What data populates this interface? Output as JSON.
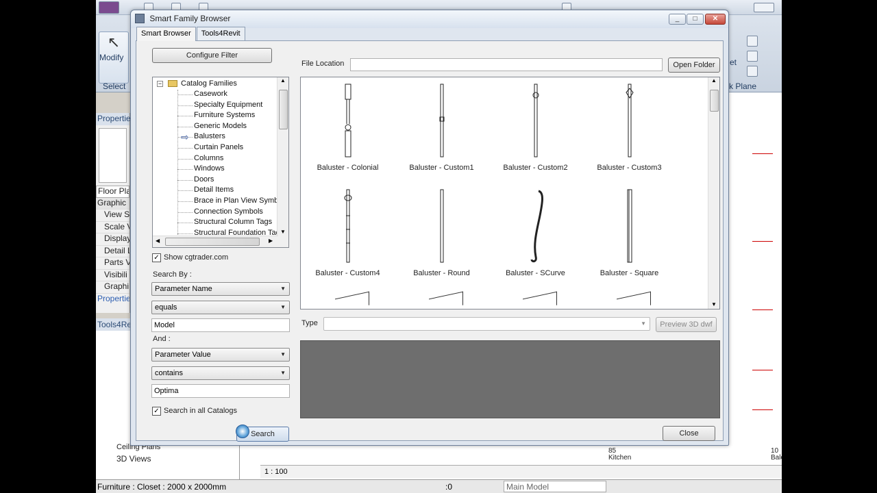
{
  "background": {
    "modify_label": "Modify",
    "select_label": "Select",
    "work_plane_label": "rk Plane",
    "et_label": "et",
    "properties_header": "Propertie",
    "properties_rows": [
      "Floor Pla",
      "Graphic",
      "View S",
      "Scale Va",
      "Display",
      "Detail L",
      "Parts V",
      "Visibili",
      "Graphi",
      "Propertie"
    ],
    "tools4revit_header": "Tools4Re",
    "tree_items": [
      "Ceiling Plans",
      "3D Views"
    ],
    "scale_label": "1 : 100",
    "status_text": "Furniture : Closet : 2000 x 2000mm",
    "status_zero": ":0",
    "main_model": "Main Model",
    "room_labels": [
      "85",
      "Kitchen",
      "10",
      "Balcony"
    ]
  },
  "dialog": {
    "title": "Smart Family Browser",
    "tabs": [
      "Smart Browser",
      "Tools4Revit"
    ],
    "configure_filter": "Configure Filter",
    "file_location_label": "File Location",
    "file_location_value": "",
    "open_folder": "Open Folder",
    "tree": {
      "root": "Catalog Families",
      "items": [
        "Casework",
        "Specialty Equipment",
        "Furniture Systems",
        "Generic Models",
        "Balusters",
        "Curtain Panels",
        "Columns",
        "Windows",
        "Doors",
        "Detail Items",
        "Brace in Plan View Symbo",
        "Connection Symbols",
        "Structural Column Tags",
        "Structural Foundation Tag"
      ],
      "selected": "Balusters"
    },
    "show_cgtrader": "Show cgtrader.com",
    "search_by_label": "Search By :",
    "search_by_value": "Parameter Name",
    "operator1": "equals",
    "value1": "Model",
    "and_label": "And :",
    "param2": "Parameter Value",
    "operator2": "contains",
    "value2": "Optima",
    "search_all": "Search in all Catalogs",
    "search_button": "Search",
    "type_label": "Type",
    "type_value": "",
    "preview_3d": "Preview 3D dwf",
    "close": "Close",
    "families": [
      {
        "name": "Baluster - Colonial"
      },
      {
        "name": "Baluster - Custom1"
      },
      {
        "name": "Baluster - Custom2"
      },
      {
        "name": "Baluster - Custom3"
      },
      {
        "name": "Baluster - Custom4"
      },
      {
        "name": "Baluster - Round"
      },
      {
        "name": "Baluster - SCurve"
      },
      {
        "name": "Baluster - Square"
      }
    ]
  },
  "colors": {
    "dialog_bg": "#dfe6ef",
    "preview_bg": "#6e6e6e",
    "red_line": "#cc0000"
  }
}
